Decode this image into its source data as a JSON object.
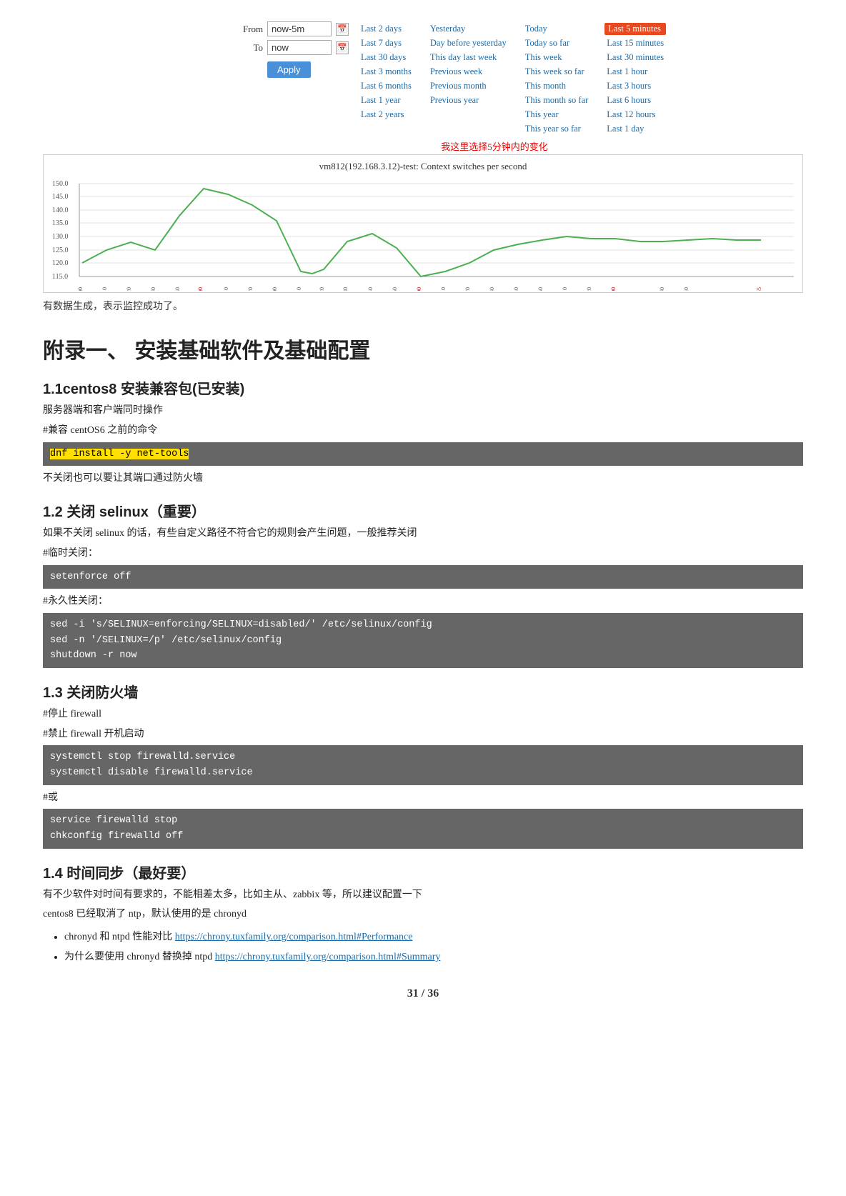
{
  "timePicker": {
    "fromLabel": "From",
    "toLabel": "To",
    "fromValue": "now-5m",
    "toValue": "now",
    "applyLabel": "Apply",
    "quickRanges": {
      "col1": [
        {
          "label": "Last 2 days",
          "active": false
        },
        {
          "label": "Last 7 days",
          "active": false
        },
        {
          "label": "Last 30 days",
          "active": false
        },
        {
          "label": "Last 3 months",
          "active": false
        },
        {
          "label": "Last 6 months",
          "active": false
        },
        {
          "label": "Last 1 year",
          "active": false
        },
        {
          "label": "Last 2 years",
          "active": false
        }
      ],
      "col2": [
        {
          "label": "Yesterday",
          "active": false
        },
        {
          "label": "Day before yesterday",
          "active": false
        },
        {
          "label": "This day last week",
          "active": false
        },
        {
          "label": "Previous week",
          "active": false
        },
        {
          "label": "Previous month",
          "active": false
        },
        {
          "label": "Previous year",
          "active": false
        }
      ],
      "col3": [
        {
          "label": "Today",
          "active": false
        },
        {
          "label": "Today so far",
          "active": false
        },
        {
          "label": "This week",
          "active": false
        },
        {
          "label": "This week so far",
          "active": false
        },
        {
          "label": "This month",
          "active": false
        },
        {
          "label": "This month so far",
          "active": false
        },
        {
          "label": "This year",
          "active": false
        },
        {
          "label": "This year so far",
          "active": false
        }
      ],
      "col4": [
        {
          "label": "Last 5 minutes",
          "active": true
        },
        {
          "label": "Last 15 minutes",
          "active": false
        },
        {
          "label": "Last 30 minutes",
          "active": false
        },
        {
          "label": "Last 1 hour",
          "active": false
        },
        {
          "label": "Last 3 hours",
          "active": false
        },
        {
          "label": "Last 6 hours",
          "active": false
        },
        {
          "label": "Last 12 hours",
          "active": false
        },
        {
          "label": "Last 1 day",
          "active": false
        }
      ]
    }
  },
  "annotation": "我这里选择5分钟内的变化",
  "chart": {
    "title": "vm812(192.168.3.12)-test: Context switches per second",
    "yLabels": [
      "115.0",
      "120.0",
      "125.0",
      "130.0",
      "135.0",
      "140.0",
      "145.0",
      "150.0"
    ],
    "xLabels": [
      "15:11:00",
      "15:11:10",
      "15:11:20",
      "15:11:30",
      "15:11:40",
      "15:11:50",
      "15:12:00",
      "15:12:10",
      "15:12:20",
      "15:12:30",
      "15:12:40",
      "15:12:50",
      "15:13:00",
      "15:13:10",
      "15:13:20",
      "15:13:30",
      "15:13:40",
      "15:13:50",
      "15:14:00",
      "15:14:10",
      "15:14:20",
      "15:14:30",
      "15:14:40",
      "15:14:50",
      "15:15:00",
      "15:15:10",
      "15:15:20",
      "15:15:30",
      "15:15:40",
      "15:15:45"
    ],
    "highlightXLabels": [
      "15:12:00",
      "15:13:00",
      "15:14:00",
      "15:15:00",
      "15:15:45"
    ]
  },
  "successNote": "有数据生成，表示监控成功了。",
  "appendix": {
    "title": "附录一、 安装基础软件及基础配置",
    "sections": [
      {
        "id": "1.1",
        "title": "1.1centos8 安装兼容包(已安装)",
        "bodyLines": [
          "服务器端和客户端同时操作",
          "#兼容 centOS6 之前的命令"
        ],
        "codeBlocks": [
          {
            "text": "dnf install -y net-tools",
            "highlight": true
          }
        ],
        "afterCode": [
          "不关闭也可以要让其端口通过防火墙"
        ]
      },
      {
        "id": "1.2",
        "title": "1.2 关闭 selinux（重要）",
        "bodyLines": [
          "如果不关闭 selinux 的话，有些自定义路径不符合它的规则会产生问题，一般推荐关闭",
          "#临时关闭："
        ],
        "codeBlocks": [
          {
            "text": "setenforce off",
            "highlight": false
          }
        ],
        "afterCode": [
          "#永久性关闭："
        ],
        "codeBlock2": "sed -i 's/SELINUX=enforcing/SELINUX=disabled/' /etc/selinux/config\nsed -n '/SELINUX=/p' /etc/selinux/config\nshutdown -r now"
      },
      {
        "id": "1.3",
        "title": "1.3 关闭防火墙",
        "bodyLines": [
          "#停止 firewall",
          "#禁止 firewall 开机启动"
        ],
        "codeBlock1": "systemctl stop firewalld.service\nsystemctl disable firewalld.service",
        "afterCode": [
          "#或"
        ],
        "codeBlock2": "service firewalld stop\nchkconfig firewalld off"
      },
      {
        "id": "1.4",
        "title": "1.4 时间同步（最好要）",
        "bodyLines": [
          "有不少软件对时间有要求的，不能相差太多，比如主从、zabbix 等，所以建议配置一下",
          "centos8 已经取消了 ntp，默认使用的是 chronyd"
        ],
        "bullets": [
          {
            "text": "chronyd 和 ntpd 性能对比 ",
            "link": "https://chrony.tuxfamily.org/comparison.html#Performance"
          },
          {
            "text": "为什么要使用 chronyd 替换掉 ntpd ",
            "link": "https://chrony.tuxfamily.org/comparison.html#Summary"
          }
        ]
      }
    ]
  },
  "pageNumber": "31 / 36"
}
